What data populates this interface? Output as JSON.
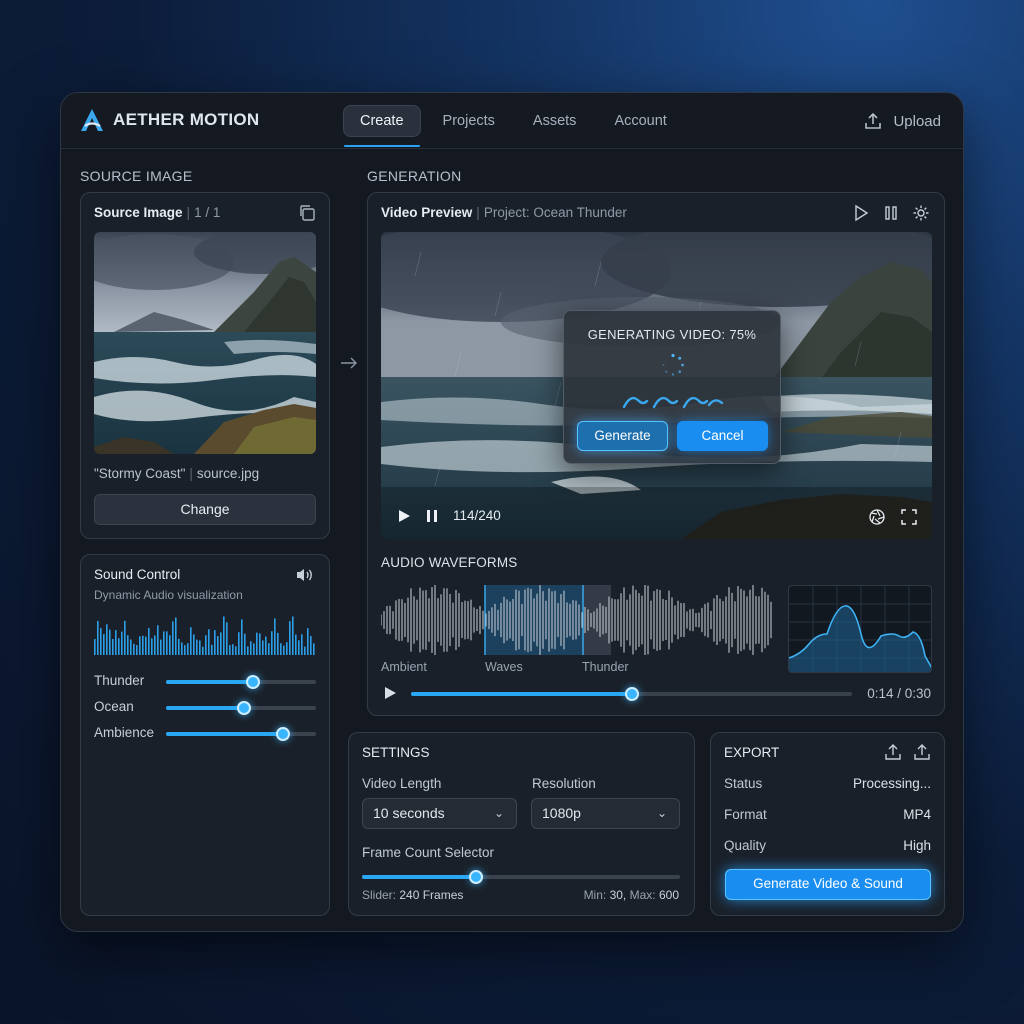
{
  "app": {
    "name": "AETHER MOTION",
    "upload_label": "Upload"
  },
  "nav": {
    "tabs": [
      {
        "label": "Create",
        "active": true
      },
      {
        "label": "Projects"
      },
      {
        "label": "Assets"
      },
      {
        "label": "Account"
      }
    ]
  },
  "source": {
    "section_label": "SOURCE IMAGE",
    "panel_title": "Source Image",
    "counter": "1 / 1",
    "caption_name": "\"Stormy Coast\"",
    "caption_file": "source.jpg",
    "change_label": "Change"
  },
  "sound": {
    "title": "Sound Control",
    "subtitle": "Dynamic Audio visualization",
    "sliders": [
      {
        "label": "Thunder",
        "value": 0.58
      },
      {
        "label": "Ocean",
        "value": 0.52
      },
      {
        "label": "Ambience",
        "value": 0.78
      }
    ]
  },
  "generation": {
    "section_label": "GENERATION",
    "preview_title": "Video Preview",
    "project_label": "Project: Ocean Thunder",
    "modal_title": "GENERATING VIDEO: 75%",
    "progress": 0.75,
    "generate_label": "Generate",
    "cancel_label": "Cancel",
    "frame_counter": "114/240",
    "waveforms_label": "AUDIO WAVEFORMS",
    "track_labels": [
      "Ambient",
      "Waves",
      "Thunder"
    ],
    "playback_position": 0.5,
    "time": "0:14 / 0:30"
  },
  "settings": {
    "title": "SETTINGS",
    "length_label": "Video Length",
    "length_value": "10 seconds",
    "resolution_label": "Resolution",
    "resolution_value": "1080p",
    "frame_label": "Frame Count Selector",
    "frame_value": 0.36,
    "slider_prefix": "Slider:",
    "slider_value": "240 Frames",
    "min_prefix": "Min:",
    "min_value": "30,",
    "max_prefix": "Max:",
    "max_value": "600"
  },
  "export": {
    "title": "EXPORT",
    "status_label": "Status",
    "status_value": "Processing...",
    "format_label": "Format",
    "format_value": "MP4",
    "quality_label": "Quality",
    "quality_value": "High",
    "generate_label": "Generate Video & Sound"
  },
  "colors": {
    "accent": "#2aa7f2",
    "panel": "#1a2029",
    "window": "#141921"
  }
}
